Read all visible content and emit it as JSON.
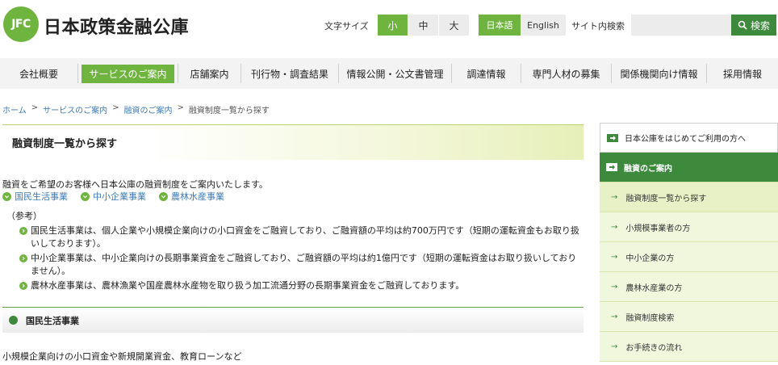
{
  "header": {
    "logo_mark": "JFC",
    "logo_text": "日本政策金融公庫",
    "font_size_label": "文字サイズ",
    "font_sizes": [
      "小",
      "中",
      "大"
    ],
    "languages": [
      "日本語",
      "English"
    ],
    "search_label": "サイト内検索",
    "search_placeholder": "",
    "search_button": "検索"
  },
  "nav": [
    {
      "label": "会社概要"
    },
    {
      "label": "サービスのご案内"
    },
    {
      "label": "店舗案内"
    },
    {
      "label": "刊行物・調査結果"
    },
    {
      "label": "情報公開・公文書管理"
    },
    {
      "label": "調達情報"
    },
    {
      "label": "専門人材の募集"
    },
    {
      "label": "関係機関向け情報"
    },
    {
      "label": "採用情報"
    }
  ],
  "breadcrumb": {
    "items": [
      "ホーム",
      "サービスのご案内",
      "融資のご案内"
    ],
    "current": "融資制度一覧から探す"
  },
  "main": {
    "title": "融資制度一覧から探す",
    "intro": "融資をご希望のお客様へ日本公庫の融資制度をご案内いたします。",
    "links": [
      "国民生活事業",
      "中小企業事業",
      "農林水産事業"
    ],
    "ref_label": "（参考）",
    "ref_items": [
      "国民生活事業は、個人企業や小規模企業向けの小口資金をご融資しており、ご融資額の平均は約700万円です（短期の運転資金もお取り扱いしております）。",
      "中小企業事業は、中小企業向けの長期事業資金をご融資しており、ご融資額の平均は約1億円です（短期の運転資金はお取り扱いしておりません）。",
      "農林水産事業は、農林漁業や国産農林水産物を取り扱う加工流通分野の長期事業資金をご融資しております。"
    ],
    "section_title": "国民生活事業",
    "section_text": "小規模企業向けの小口資金や新規開業資金、教育ローンなど"
  },
  "sidebar": [
    {
      "label": "日本公庫をはじめてご利用の方へ"
    },
    {
      "label": "融資のご案内"
    },
    {
      "label": "融資制度一覧から探す"
    },
    {
      "label": "小規模事業者の方"
    },
    {
      "label": "中小企業の方"
    },
    {
      "label": "農林水産業の方"
    },
    {
      "label": "融資制度検索"
    },
    {
      "label": "お手続きの流れ"
    }
  ],
  "colors": {
    "accent_green": "#6fb43f",
    "dark_green": "#3d8a3d",
    "link_blue": "#3d7ab5"
  }
}
